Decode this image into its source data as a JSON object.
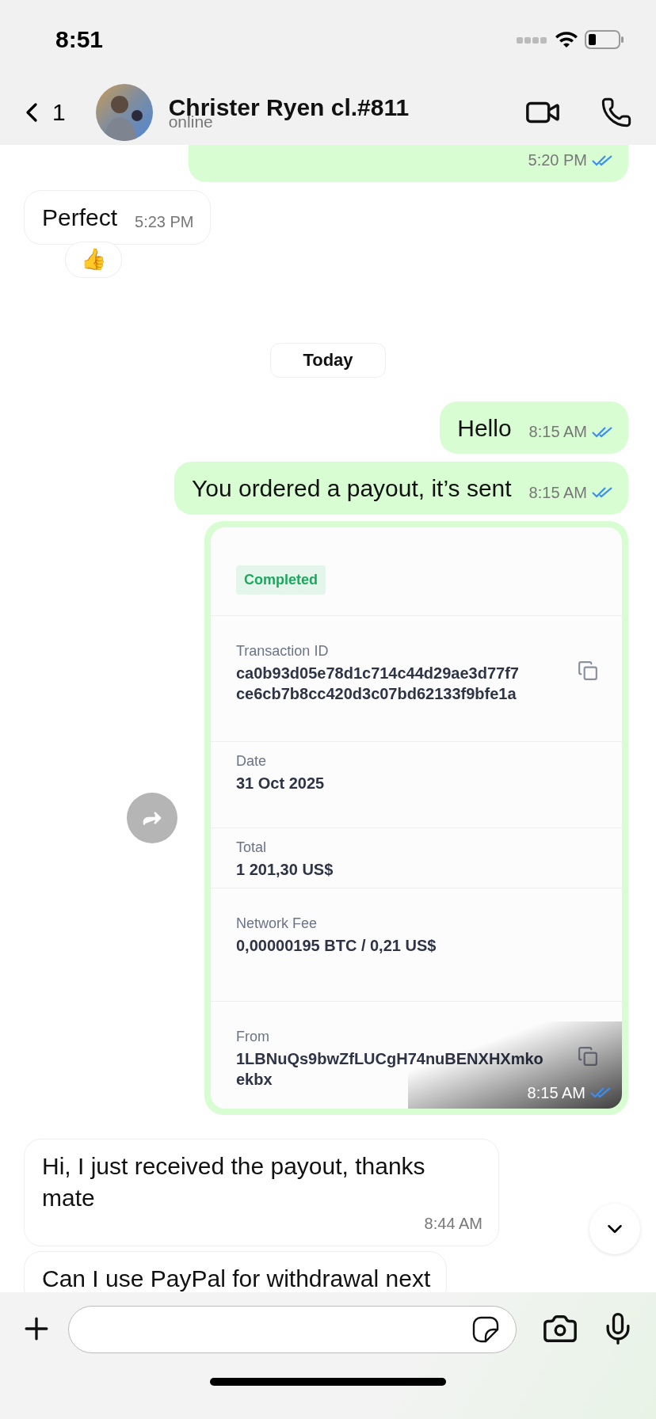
{
  "status_bar": {
    "time": "8:51"
  },
  "header": {
    "back_count": "1",
    "name": "Christer Ryen cl.#811",
    "status": "online"
  },
  "messages": [
    {
      "kind": "sent",
      "time": "5:20 PM",
      "read": true
    },
    {
      "kind": "received",
      "text": "Perfect",
      "time": "5:23 PM",
      "reaction": "👍"
    },
    {
      "kind": "date",
      "text": "Today"
    },
    {
      "kind": "sent",
      "text": "Hello",
      "time": "8:15 AM",
      "read": true
    },
    {
      "kind": "sent",
      "text": "You ordered a payout, it’s sent",
      "time": "8:15 AM",
      "read": true
    },
    {
      "kind": "card",
      "time": "8:15 AM",
      "read": true,
      "badge": "Completed",
      "fields": [
        {
          "label": "Transaction ID",
          "value": "ca0b93d05e78d1c714c44d29ae3d77f7 ce6cb7b8cc420d3c07bd62133f9bfe1a",
          "copyable": true
        },
        {
          "label": "Date",
          "value": "31 Oct 2025",
          "copyable": false
        },
        {
          "label": "Total",
          "value": "1 201,30 US$",
          "copyable": false
        },
        {
          "label": "Network Fee",
          "value": "0,00000195 BTC / 0,21 US$",
          "copyable": false
        },
        {
          "label": "From",
          "value": "1LBNuQs9bwZfLUCgH74nuBENXHXmko ekbx",
          "copyable": true
        }
      ]
    },
    {
      "kind": "received",
      "text": "Hi, I just received the payout, thanks mate",
      "time": "8:44 AM"
    },
    {
      "kind": "received",
      "text": "Can I use PayPal for withdrawal next"
    }
  ]
}
